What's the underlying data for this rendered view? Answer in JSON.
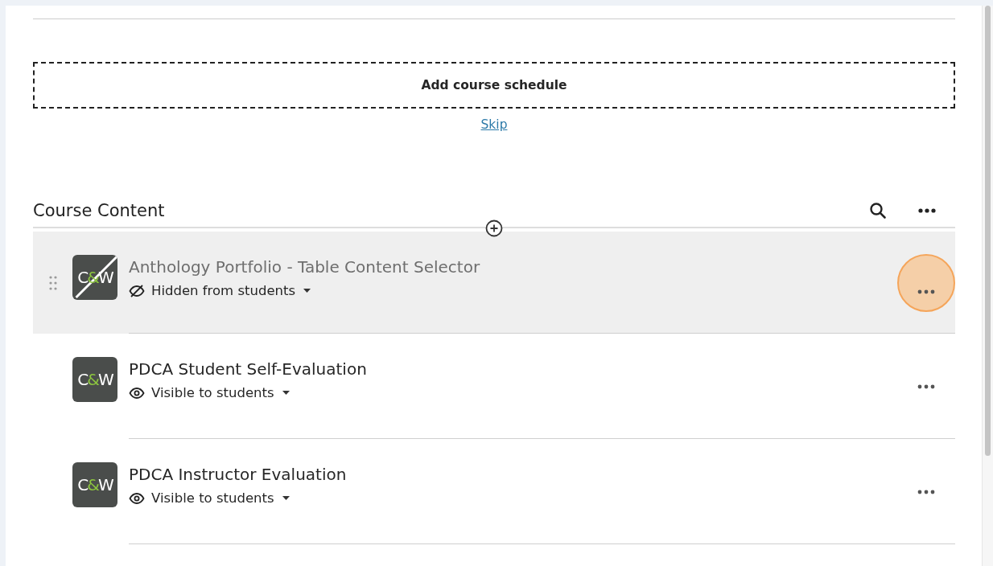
{
  "schedule": {
    "add_label": "Add course schedule",
    "skip_link": "Skip"
  },
  "course_content": {
    "title": "Course Content",
    "items": [
      {
        "title": "Anthology Portfolio - Table Content Selector",
        "hidden": true,
        "visibility_label": "Hidden from students",
        "highlighted": true,
        "click_marker": true,
        "logo": [
          {
            "text": "C"
          },
          {
            "text": "&",
            "color": "#8dc63f"
          },
          {
            "text": "W"
          }
        ]
      },
      {
        "title": "PDCA Student Self-Evaluation",
        "hidden": false,
        "visibility_label": "Visible to students",
        "highlighted": false,
        "click_marker": false,
        "logo": [
          {
            "text": "C"
          },
          {
            "text": "&",
            "color": "#8dc63f"
          },
          {
            "text": "W"
          }
        ]
      },
      {
        "title": "PDCA Instructor Evaluation",
        "hidden": false,
        "visibility_label": "Visible to students",
        "highlighted": false,
        "click_marker": false,
        "logo": [
          {
            "text": "C"
          },
          {
            "text": "&",
            "color": "#8dc63f"
          },
          {
            "text": "W"
          }
        ]
      }
    ]
  }
}
